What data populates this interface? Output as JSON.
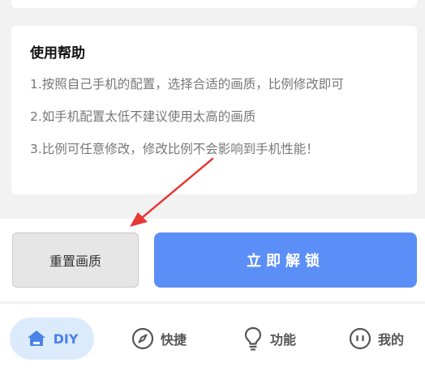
{
  "help": {
    "title": "使用帮助",
    "lines": [
      "1.按照自己手机的配置，选择合适的画质，比例修改即可",
      "2.如手机配置太低不建议使用太高的画质",
      "3.比例可任意修改，修改比例不会影响到手机性能！"
    ]
  },
  "actions": {
    "reset_label": "重置画质",
    "unlock_label": "立即解锁"
  },
  "tabs": {
    "diy": "DIY",
    "quick": "快捷",
    "func": "功能",
    "mine": "我的"
  },
  "colors": {
    "accent": "#5b8ef7",
    "tab_active_bg": "#dcebfc",
    "tab_active_text": "#4a82e8",
    "annotation_arrow": "#e53935"
  },
  "icons": {
    "diy": "home-icon",
    "quick": "compass-icon",
    "func": "lightbulb-icon",
    "mine": "face-icon"
  }
}
